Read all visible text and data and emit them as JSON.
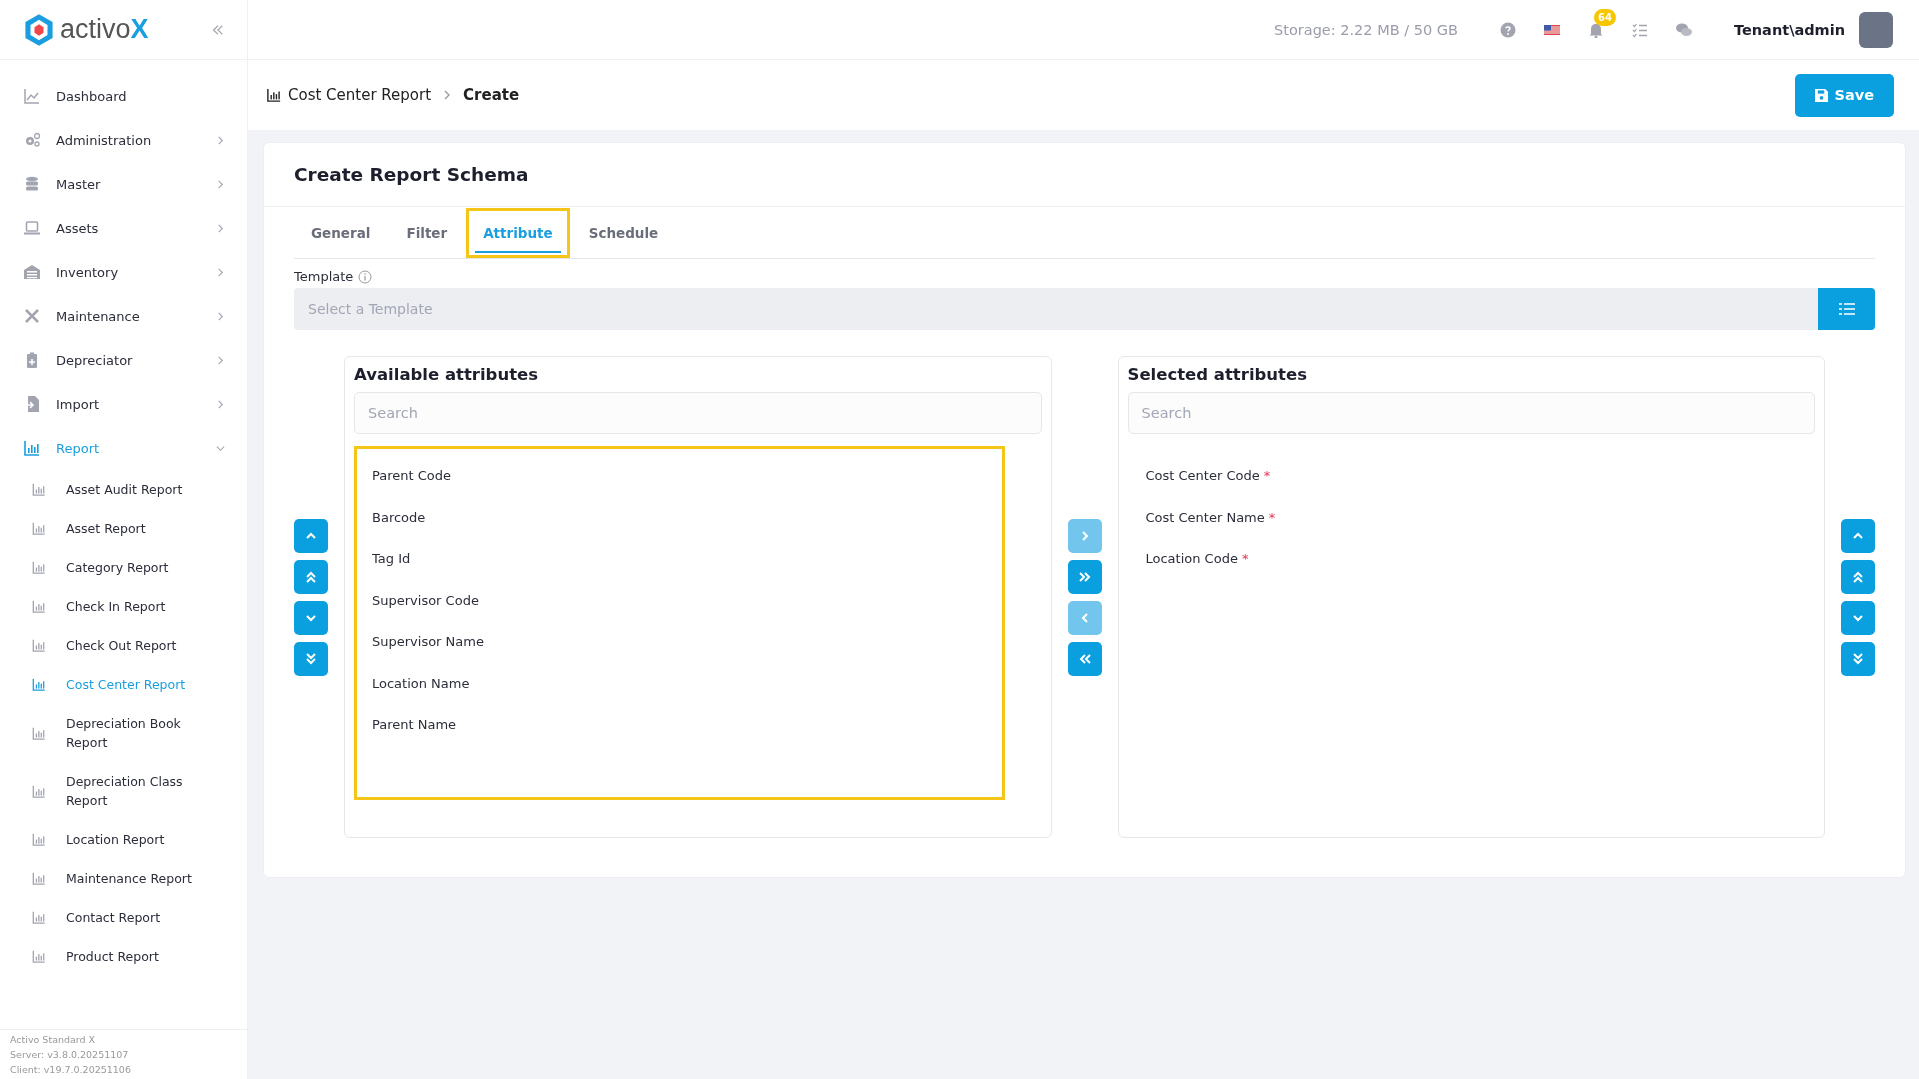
{
  "logo": {
    "text": "activo",
    "accent": "X"
  },
  "sidebar": {
    "items": [
      {
        "label": "Dashboard",
        "expandable": false,
        "selected": false
      },
      {
        "label": "Administration",
        "expandable": true,
        "selected": false
      },
      {
        "label": "Master",
        "expandable": true,
        "selected": false
      },
      {
        "label": "Assets",
        "expandable": true,
        "selected": false
      },
      {
        "label": "Inventory",
        "expandable": true,
        "selected": false
      },
      {
        "label": "Maintenance",
        "expandable": true,
        "selected": false
      },
      {
        "label": "Depreciator",
        "expandable": true,
        "selected": false
      },
      {
        "label": "Import",
        "expandable": true,
        "selected": false
      },
      {
        "label": "Report",
        "expandable": true,
        "expanded": true,
        "selected": true,
        "children": [
          {
            "label": "Asset Audit Report",
            "selected": false
          },
          {
            "label": "Asset Report",
            "selected": false
          },
          {
            "label": "Category Report",
            "selected": false
          },
          {
            "label": "Check In Report",
            "selected": false
          },
          {
            "label": "Check Out Report",
            "selected": false
          },
          {
            "label": "Cost Center Report",
            "selected": true
          },
          {
            "label": "Depreciation Book Report",
            "selected": false
          },
          {
            "label": "Depreciation Class Report",
            "selected": false
          },
          {
            "label": "Location Report",
            "selected": false
          },
          {
            "label": "Maintenance Report",
            "selected": false
          },
          {
            "label": "Contact Report",
            "selected": false
          },
          {
            "label": "Product Report",
            "selected": false
          }
        ]
      }
    ],
    "footer": [
      "Activo Standard X",
      "Server: v3.8.0.20251107",
      "Client: v19.7.0.20251106"
    ]
  },
  "topbar": {
    "storage": "Storage: 2.22 MB / 50 GB",
    "notification_count": "64",
    "user": "Tenant\\admin"
  },
  "breadcrumb": [
    "Cost Center Report",
    "Create"
  ],
  "save_button": "Save",
  "card": {
    "title": "Create Report Schema",
    "tabs": [
      {
        "label": "General",
        "selected": false,
        "highlighted": false
      },
      {
        "label": "Filter",
        "selected": false,
        "highlighted": false
      },
      {
        "label": "Attribute",
        "selected": true,
        "highlighted": true
      },
      {
        "label": "Schedule",
        "selected": false,
        "highlighted": false
      }
    ],
    "template": {
      "label": "Template",
      "placeholder": "Select a Template"
    },
    "available": {
      "title": "Available attributes",
      "search_placeholder": "Search",
      "highlighted": true,
      "items": [
        {
          "label": "Parent Code"
        },
        {
          "label": "Barcode"
        },
        {
          "label": "Tag Id"
        },
        {
          "label": "Supervisor Code"
        },
        {
          "label": "Supervisor Name"
        },
        {
          "label": "Location Name"
        },
        {
          "label": "Parent Name"
        }
      ]
    },
    "selected": {
      "title": "Selected attributes",
      "search_placeholder": "Search",
      "highlighted": false,
      "items": [
        {
          "label": "Cost Center Code",
          "required": true,
          "mark": "*"
        },
        {
          "label": "Cost Center Name",
          "required": true,
          "mark": "*"
        },
        {
          "label": "Location Code",
          "required": true,
          "mark": "*"
        }
      ]
    },
    "left_order_buttons": [
      {
        "disabled": false
      },
      {
        "disabled": false
      },
      {
        "disabled": false
      },
      {
        "disabled": false
      }
    ],
    "transfer_buttons": [
      {
        "disabled": true
      },
      {
        "disabled": false
      },
      {
        "disabled": true
      },
      {
        "disabled": false
      }
    ],
    "right_order_buttons": [
      {
        "disabled": false
      },
      {
        "disabled": false
      },
      {
        "disabled": false
      },
      {
        "disabled": false
      }
    ]
  }
}
